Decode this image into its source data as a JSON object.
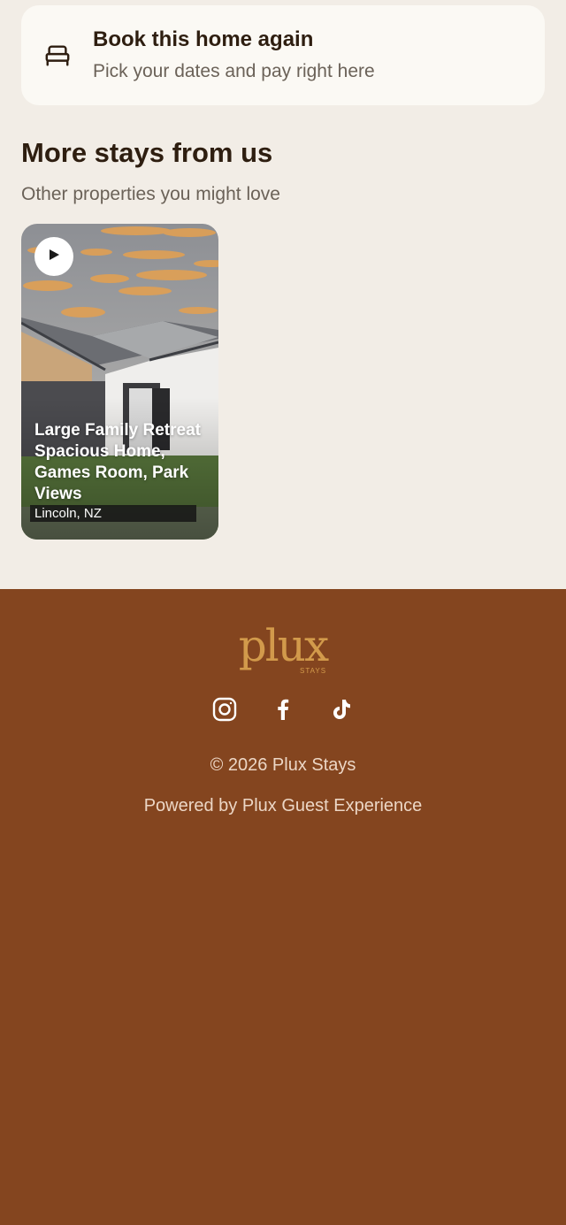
{
  "book_card": {
    "title": "Book this home again",
    "subtitle": "Pick your dates and pay right here",
    "icon": "bed-icon"
  },
  "more_stays": {
    "title": "More stays from us",
    "subtitle": "Other properties you might love",
    "cards": [
      {
        "title": "Large Family Retreat Spacious Home, Games Room, Park Views",
        "location": "Lincoln, NZ",
        "play_icon": "play-icon"
      }
    ]
  },
  "footer": {
    "logo_text": "plux",
    "logo_sub": "STAYS",
    "social_icons": [
      "instagram-icon",
      "facebook-icon",
      "tiktok-icon"
    ],
    "copyright": "© 2026 Plux Stays",
    "powered_by": "Powered by Plux Guest Experience"
  },
  "colors": {
    "background": "#f2ede6",
    "card": "#fbf9f4",
    "footer": "#84451f",
    "logo": "#d29a4b",
    "heading": "#2e1e10"
  }
}
